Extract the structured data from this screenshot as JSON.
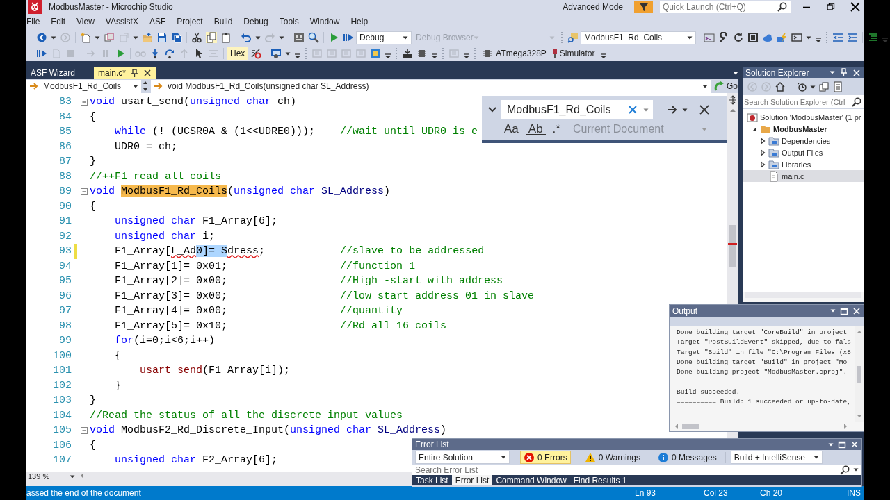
{
  "window": {
    "title": "ModbusMaster - Microchip Studio",
    "mode": "Advanced Mode",
    "quick_launch_placeholder": "Quick Launch (Ctrl+Q)"
  },
  "menu": [
    "File",
    "Edit",
    "View",
    "VAssistX",
    "ASF",
    "Project",
    "Build",
    "Debug",
    "Tools",
    "Window",
    "Help"
  ],
  "toolbar": {
    "configuration": "Debug",
    "debug_browser": {
      "label": "Debug Browser",
      "disabled": true
    },
    "function_combo": "ModbusF1_Rd_Coils",
    "hex": {
      "label": "Hex",
      "on": true
    },
    "device": "ATmega328P",
    "tool": "Simulator"
  },
  "tabs": [
    {
      "label": "ASF Wizard",
      "selected": false
    },
    {
      "label": "main.c*",
      "selected": true
    }
  ],
  "nav": {
    "scope": "ModbusF1_Rd_Coils",
    "member": "void ModbusF1_Rd_Coils(unsigned char SL_Address)",
    "go": "Go"
  },
  "find": {
    "value": "ModbusF1_Rd_Coils",
    "match_case": "Aa",
    "whole_word": "Ab",
    "regex": ".*",
    "scope": "Current Document"
  },
  "code": [
    {
      "number": "83",
      "fold": true,
      "changed": false,
      "tokens": [
        {
          "kind": "keyword",
          "text": "void"
        },
        {
          "kind": "plain",
          "text": " usart_send("
        },
        {
          "kind": "keyword",
          "text": "unsigned char"
        },
        {
          "kind": "plain",
          "text": " ch)"
        }
      ]
    },
    {
      "number": "84",
      "fold": false,
      "changed": false,
      "tokens": [
        {
          "kind": "plain",
          "text": "{"
        }
      ]
    },
    {
      "number": "85",
      "fold": false,
      "changed": false,
      "tokens": [
        {
          "kind": "keyword",
          "text": "    while"
        },
        {
          "kind": "plain",
          "text": " (! (UCSR0A & (1<<UDRE0)));    "
        },
        {
          "kind": "comment",
          "text": "//wait until UDR0 is e"
        }
      ]
    },
    {
      "number": "86",
      "fold": false,
      "changed": false,
      "tokens": [
        {
          "kind": "plain",
          "text": "    UDR0 = ch;"
        }
      ]
    },
    {
      "number": "87",
      "fold": false,
      "changed": false,
      "tokens": [
        {
          "kind": "plain",
          "text": "}"
        }
      ]
    },
    {
      "number": "88",
      "fold": false,
      "changed": false,
      "tokens": [
        {
          "kind": "comment",
          "text": "//++F1 read all coils"
        }
      ]
    },
    {
      "number": "89",
      "fold": true,
      "changed": false,
      "tokens": [
        {
          "kind": "keyword",
          "text": "void "
        },
        {
          "kind": "match",
          "text": "ModbusF1_Rd_Coils"
        },
        {
          "kind": "plain",
          "text": "("
        },
        {
          "kind": "keyword",
          "text": "unsigned char "
        },
        {
          "kind": "param",
          "text": "SL_Address"
        },
        {
          "kind": "plain",
          "text": ")"
        }
      ]
    },
    {
      "number": "90",
      "fold": false,
      "changed": false,
      "tokens": [
        {
          "kind": "plain",
          "text": "{"
        }
      ]
    },
    {
      "number": "91",
      "fold": false,
      "changed": false,
      "tokens": [
        {
          "kind": "keyword",
          "text": "    unsigned char"
        },
        {
          "kind": "plain",
          "text": " F1_Array[6];"
        }
      ]
    },
    {
      "number": "92",
      "fold": false,
      "changed": false,
      "tokens": [
        {
          "kind": "keyword",
          "text": "    unsigned char"
        },
        {
          "kind": "plain",
          "text": " i;"
        }
      ]
    },
    {
      "number": "93",
      "fold": false,
      "changed": true,
      "tokens": [
        {
          "kind": "plain",
          "text": "    F1_Array["
        },
        {
          "kind": "error",
          "text": "L_Ad"
        },
        {
          "kind": "selected",
          "text": "0]= S"
        },
        {
          "kind": "error",
          "text": "dress"
        },
        {
          "kind": "plain",
          "text": ";            "
        },
        {
          "kind": "comment",
          "text": "//slave to be addressed"
        }
      ]
    },
    {
      "number": "94",
      "fold": false,
      "changed": false,
      "tokens": [
        {
          "kind": "plain",
          "text": "    F1_Array[1]= 0x01;                  "
        },
        {
          "kind": "comment",
          "text": "//function 1"
        }
      ]
    },
    {
      "number": "95",
      "fold": false,
      "changed": false,
      "tokens": [
        {
          "kind": "plain",
          "text": "    F1_Array[2]= 0x00;                  "
        },
        {
          "kind": "comment",
          "text": "//High -start with address"
        }
      ]
    },
    {
      "number": "96",
      "fold": false,
      "changed": false,
      "tokens": [
        {
          "kind": "plain",
          "text": "    F1_Array[3]= 0x00;                  "
        },
        {
          "kind": "comment",
          "text": "//low start address 01 in slave"
        }
      ]
    },
    {
      "number": "97",
      "fold": false,
      "changed": false,
      "tokens": [
        {
          "kind": "plain",
          "text": "    F1_Array[4]= 0x00;                  "
        },
        {
          "kind": "comment",
          "text": "//quantity"
        }
      ]
    },
    {
      "number": "98",
      "fold": false,
      "changed": false,
      "tokens": [
        {
          "kind": "plain",
          "text": "    F1_Array[5]= 0x10;                  "
        },
        {
          "kind": "comment",
          "text": "//Rd all 16 coils"
        }
      ]
    },
    {
      "number": "99",
      "fold": false,
      "changed": false,
      "tokens": [
        {
          "kind": "keyword",
          "text": "    for"
        },
        {
          "kind": "plain",
          "text": "(i=0;i<6;i++)"
        }
      ]
    },
    {
      "number": "100",
      "fold": false,
      "changed": false,
      "tokens": [
        {
          "kind": "plain",
          "text": "    {"
        }
      ]
    },
    {
      "number": "101",
      "fold": false,
      "changed": false,
      "tokens": [
        {
          "kind": "call",
          "text": "        usart_send"
        },
        {
          "kind": "plain",
          "text": "(F1_Array[i]);"
        }
      ]
    },
    {
      "number": "102",
      "fold": false,
      "changed": false,
      "tokens": [
        {
          "kind": "plain",
          "text": "    }"
        }
      ]
    },
    {
      "number": "103",
      "fold": false,
      "changed": false,
      "tokens": [
        {
          "kind": "plain",
          "text": "}"
        }
      ]
    },
    {
      "number": "104",
      "fold": false,
      "changed": false,
      "tokens": [
        {
          "kind": "comment",
          "text": "//Read the status of all the discrete input values"
        }
      ]
    },
    {
      "number": "105",
      "fold": true,
      "changed": false,
      "tokens": [
        {
          "kind": "keyword",
          "text": "void"
        },
        {
          "kind": "plain",
          "text": " ModbusF2_Rd_Discrete_Input("
        },
        {
          "kind": "keyword",
          "text": "unsigned char "
        },
        {
          "kind": "param",
          "text": "SL_Address"
        },
        {
          "kind": "plain",
          "text": ")"
        }
      ]
    },
    {
      "number": "106",
      "fold": false,
      "changed": false,
      "tokens": [
        {
          "kind": "plain",
          "text": "{"
        }
      ]
    },
    {
      "number": "107",
      "fold": false,
      "changed": false,
      "tokens": [
        {
          "kind": "keyword",
          "text": "    unsigned char"
        },
        {
          "kind": "plain",
          "text": " F2_Array[6];"
        }
      ]
    }
  ],
  "zoom": "139 %",
  "solution_explorer": {
    "title": "Solution Explorer",
    "search_placeholder": "Search Solution Explorer (Ctrl",
    "tree": [
      {
        "label": "Solution 'ModbusMaster' (1 pr",
        "kind": "solution",
        "selected": false,
        "children": [
          {
            "label": "ModbusMaster",
            "kind": "project",
            "expanded": true,
            "selected": false,
            "children": [
              {
                "label": "Dependencies",
                "kind": "folder",
                "expanded": false,
                "selected": false
              },
              {
                "label": "Output Files",
                "kind": "folder",
                "expanded": false,
                "selected": false
              },
              {
                "label": "Libraries",
                "kind": "folder",
                "expanded": false,
                "selected": false
              },
              {
                "label": "main.c",
                "kind": "file",
                "selected": true
              }
            ]
          }
        ]
      }
    ]
  },
  "output": {
    "title": "Output",
    "lines": [
      "Done building target \"CoreBuild\" in project ",
      "Target \"PostBuildEvent\" skipped, due to fals",
      "Target \"Build\" in file \"C:\\Program Files (x8",
      "Done building target \"Build\" in project \"Mo",
      "Done building project \"ModbusMaster.cproj\"."
    ],
    "summary_lines": [
      "Build succeeded.",
      "========== Build: 1 succeeded or up-to-date,"
    ]
  },
  "error_list": {
    "title": "Error List",
    "scope": "Entire Solution",
    "filters": [
      {
        "label": "0 Errors",
        "kind": "error",
        "selected": true
      },
      {
        "label": "0 Warnings",
        "kind": "warning",
        "selected": false
      },
      {
        "label": "0 Messages",
        "kind": "info",
        "selected": false
      }
    ],
    "source": "Build + IntelliSense",
    "search_placeholder": "Search Error List",
    "tabs": [
      {
        "label": "Task List",
        "selected": false
      },
      {
        "label": "Error List",
        "selected": true
      },
      {
        "label": "Command Window",
        "selected": false
      },
      {
        "label": "Find Results 1",
        "selected": false
      }
    ]
  },
  "status_bar": {
    "message": "assed the end of the document",
    "line": "Ln 93",
    "column": "Col 23",
    "char": "Ch 20",
    "mode": "INS"
  }
}
